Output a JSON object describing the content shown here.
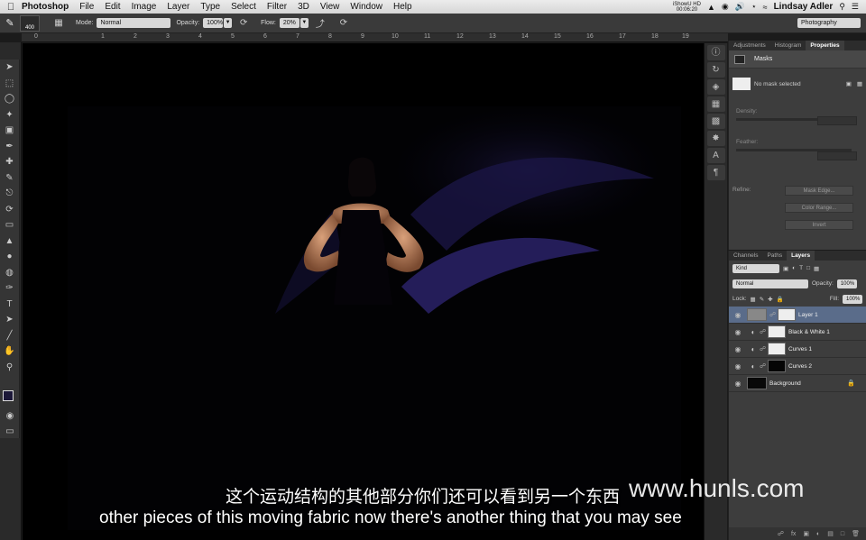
{
  "menubar": {
    "app_name": "Photoshop",
    "items": [
      "File",
      "Edit",
      "Image",
      "Layer",
      "Type",
      "Select",
      "Filter",
      "3D",
      "View",
      "Window",
      "Help"
    ],
    "status_top": "iShowU HD",
    "status_bottom": "00:06:20",
    "user": "Lindsay Adler"
  },
  "options": {
    "brush_size": "400",
    "mode_label": "Mode:",
    "mode_value": "Normal",
    "opacity_label": "Opacity:",
    "opacity_value": "100%",
    "flow_label": "Flow:",
    "flow_value": "20%",
    "workspace": "Photography"
  },
  "ruler_ticks": [
    "0",
    "1",
    "2",
    "3",
    "4",
    "5",
    "6",
    "7",
    "8",
    "9",
    "10",
    "11",
    "12",
    "13",
    "14",
    "15",
    "16",
    "17",
    "18",
    "19"
  ],
  "properties_panel": {
    "tabs": [
      "Adjustments",
      "Histogram",
      "Properties"
    ],
    "active_tab": "Properties",
    "section": "Masks",
    "status": "No mask selected",
    "density_label": "Density:",
    "feather_label": "Feather:",
    "refine_label": "Refine:",
    "buttons": [
      "Mask Edge...",
      "Color Range...",
      "Invert"
    ]
  },
  "layers_panel": {
    "tabs": [
      "Channels",
      "Paths",
      "Layers"
    ],
    "active_tab": "Layers",
    "filter": "Kind",
    "blend_mode": "Normal",
    "opacity_label": "Opacity:",
    "opacity_value": "100%",
    "lock_label": "Lock:",
    "fill_label": "Fill:",
    "fill_value": "100%",
    "layers": [
      {
        "name": "Layer 1",
        "active": true
      },
      {
        "name": "Black & White 1",
        "active": false
      },
      {
        "name": "Curves 1",
        "active": false
      },
      {
        "name": "Curves 2",
        "active": false
      },
      {
        "name": "Background",
        "active": false
      }
    ]
  },
  "subtitles": {
    "chinese": "这个运动结构的其他部分你们还可以看到另一个东西",
    "english": "other pieces of this moving fabric now there's another thing that you may see"
  },
  "watermark": "www.hunls.com",
  "colors": {
    "foreground": "#1c1838",
    "background": "#ffffff",
    "layer_highlight": "#5a6c8a"
  }
}
